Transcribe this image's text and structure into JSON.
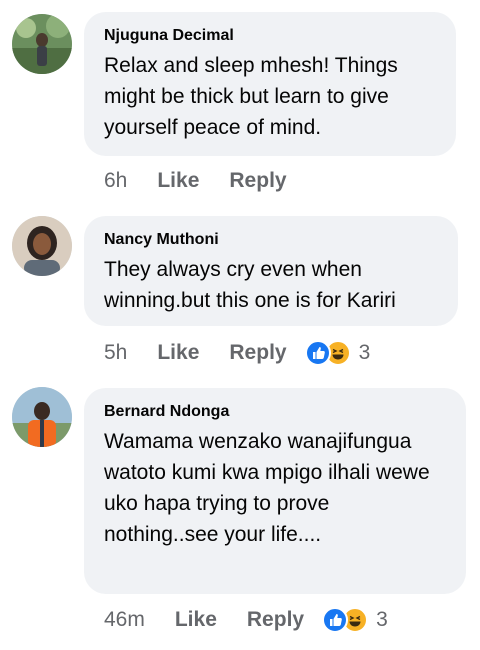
{
  "comments": [
    {
      "author": "Njuguna Decimal",
      "text": "Relax and sleep mhesh! Things might be thick but learn to give yourself peace of mind.",
      "time": "6h",
      "like_label": "Like",
      "reply_label": "Reply",
      "avatar_icon": "profile-photo"
    },
    {
      "author": "Nancy Muthoni",
      "text": "They always cry even when winning.but this one is for Kariri",
      "time": "5h",
      "like_label": "Like",
      "reply_label": "Reply",
      "reaction_count": "3",
      "reaction_icons": [
        "like-icon",
        "haha-icon"
      ],
      "avatar_icon": "profile-photo"
    },
    {
      "author": "Bernard Ndonga",
      "text": "Wamama wenzako wanajifungua watoto kumi kwa mpigo ilhali wewe uko hapa trying to prove nothing..see your life....",
      "time": "46m",
      "like_label": "Like",
      "reply_label": "Reply",
      "reaction_count": "3",
      "reaction_icons": [
        "like-icon",
        "haha-icon"
      ],
      "avatar_icon": "profile-photo"
    }
  ],
  "colors": {
    "bubble_bg": "#f0f2f5",
    "meta_text": "#65676b",
    "like_blue": "#1877f2",
    "haha_yellow": "#f7b125"
  }
}
